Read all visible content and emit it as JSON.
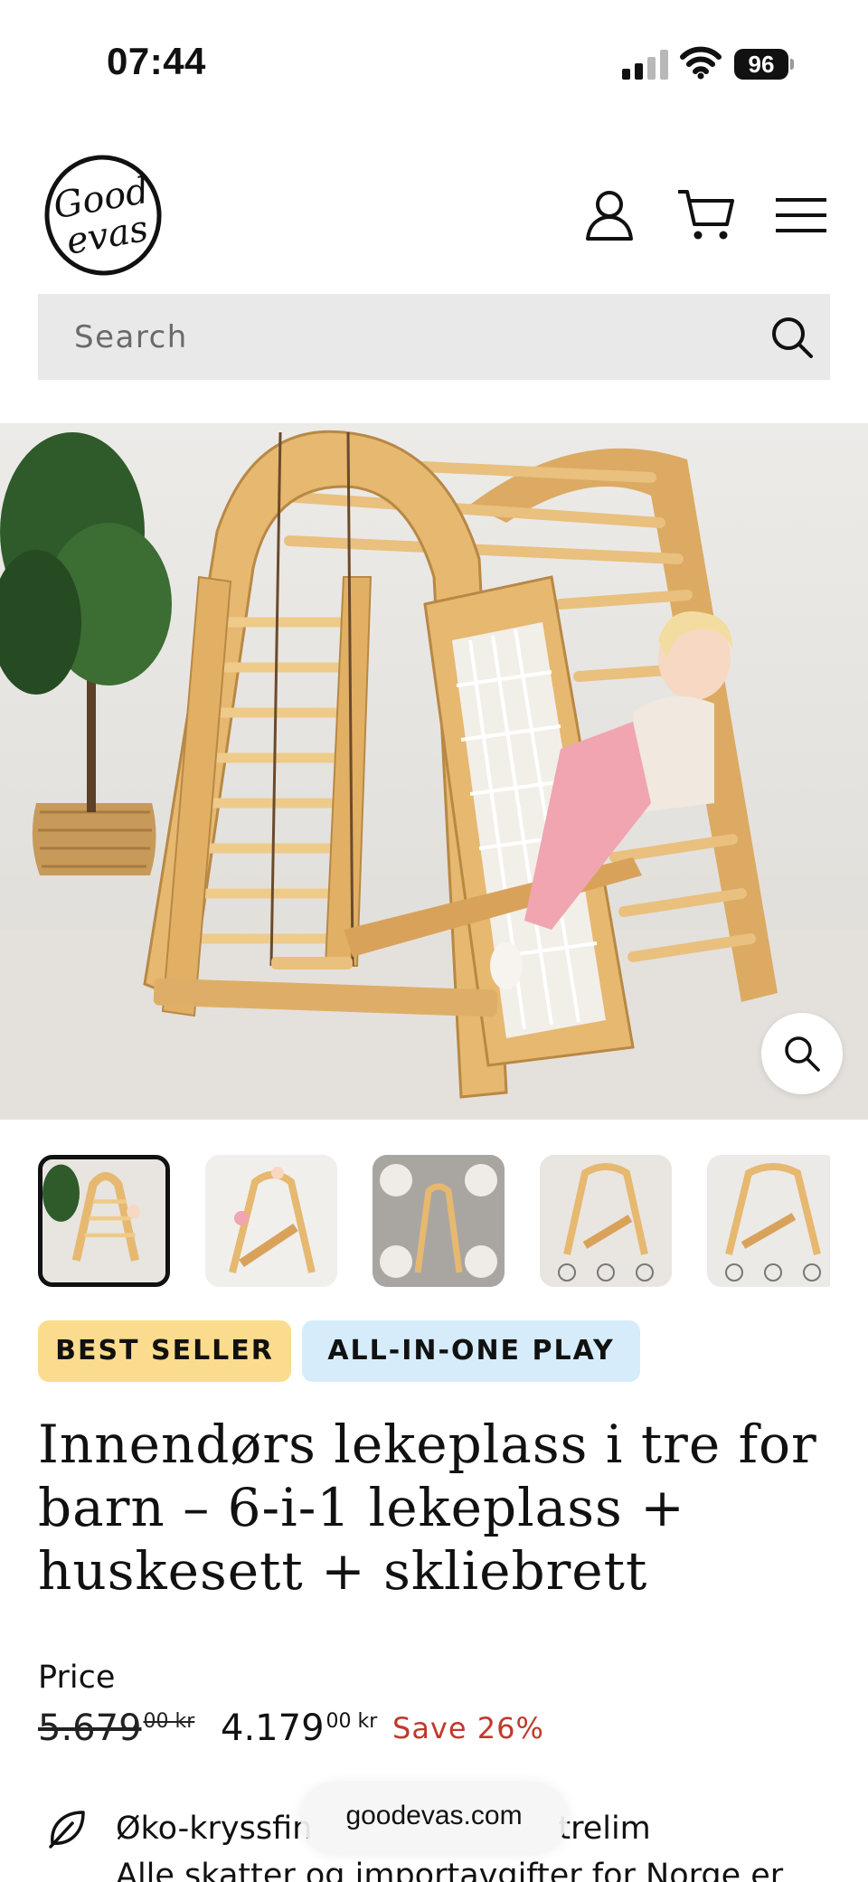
{
  "status_bar": {
    "time": "07:44",
    "battery": "96"
  },
  "header": {
    "logo_icon": "goodevas-logo",
    "logo_text_line1": "Good",
    "logo_text_line2": "evas",
    "account_icon": "user-icon",
    "cart_icon": "cart-icon",
    "menu_icon": "hamburger-menu-icon"
  },
  "search": {
    "placeholder": "Search",
    "icon": "search-icon"
  },
  "gallery": {
    "main_image": "Wooden indoor playground with climbing net, ladder, swing and child",
    "zoom_icon": "zoom-icon",
    "thumbnail_count": 5,
    "active_thumbnail": 1
  },
  "badges": {
    "best_seller": "BEST SELLER",
    "all_in_one": "ALL-IN-ONE PLAY"
  },
  "product": {
    "title_line1": "Innendørs lekeplass i tre for",
    "title_line2": "barn – 6-i-1 lekeplass +",
    "title_line3": "huskesett + skliebrett"
  },
  "price": {
    "label": "Price",
    "compare_main": "5.679",
    "compare_sup": "00 kr",
    "sale_main": "4.179",
    "sale_sup": "00 kr",
    "save": "Save 26%"
  },
  "features": {
    "item1_icon": "leaf-icon",
    "item1_start": "Øko-kryssfin",
    "item1_end": "trelim",
    "item2": "Alle skatter og importavgifter for Norge er"
  },
  "browser": {
    "url": "goodevas.com"
  },
  "colors": {
    "search_bg": "#e9e9e9",
    "badge_best_bg": "#fbdc8e",
    "badge_play_bg": "#d6ecfb",
    "save_color": "#c0392b",
    "wood": "#e6b870"
  }
}
